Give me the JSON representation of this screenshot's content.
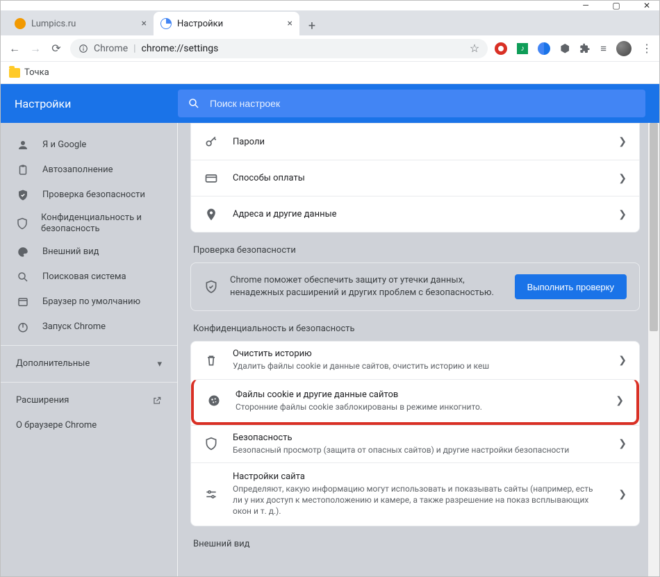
{
  "window": {
    "minimize": "—",
    "maximize": "▢",
    "close": "✕"
  },
  "tabs": [
    {
      "title": "Lumpics.ru",
      "active": false
    },
    {
      "title": "Настройки",
      "active": true
    }
  ],
  "omnibox": {
    "prefix": "Chrome",
    "path": "chrome://settings"
  },
  "ext_icons": {
    "star": "☆"
  },
  "bookmarks": {
    "folder": "Точка"
  },
  "settings": {
    "title": "Настройки",
    "search_placeholder": "Поиск настроек"
  },
  "sidebar": {
    "items": [
      {
        "label": "Я и Google",
        "icon": "person"
      },
      {
        "label": "Автозаполнение",
        "icon": "clipboard"
      },
      {
        "label": "Проверка безопасности",
        "icon": "shield-check"
      },
      {
        "label": "Конфиденциальность и безопасность",
        "icon": "shield"
      },
      {
        "label": "Внешний вид",
        "icon": "palette"
      },
      {
        "label": "Поисковая система",
        "icon": "search"
      },
      {
        "label": "Браузер по умолчанию",
        "icon": "window"
      },
      {
        "label": "Запуск Chrome",
        "icon": "power"
      }
    ],
    "advanced": "Дополнительные",
    "extensions": "Расширения",
    "about": "О браузере Chrome"
  },
  "autofill": {
    "passwords": "Пароли",
    "payment": "Способы оплаты",
    "addresses": "Адреса и другие данные"
  },
  "safety": {
    "heading": "Проверка безопасности",
    "text": "Chrome поможет обеспечить защиту от утечки данных, ненадежных расширений и других проблем с безопасностью.",
    "button": "Выполнить проверку"
  },
  "privacy": {
    "heading": "Конфиденциальность и безопасность",
    "clear_title": "Очистить историю",
    "clear_sub": "Удалить файлы cookie и данные сайтов, очистить историю и кеш",
    "cookies_title": "Файлы cookie и другие данные сайтов",
    "cookies_sub": "Сторонние файлы cookie заблокированы в режиме инкогнито.",
    "security_title": "Безопасность",
    "security_sub": "Безопасный просмотр (защита от опасных сайтов) и другие настройки безопасности",
    "site_title": "Настройки сайта",
    "site_sub": "Определяют, какую информацию могут использовать и показывать сайты (например, есть ли у них доступ к местоположению и камере, а также разрешение на показ всплывающих окон и т. д.)."
  },
  "appearance": {
    "heading": "Внешний вид"
  }
}
